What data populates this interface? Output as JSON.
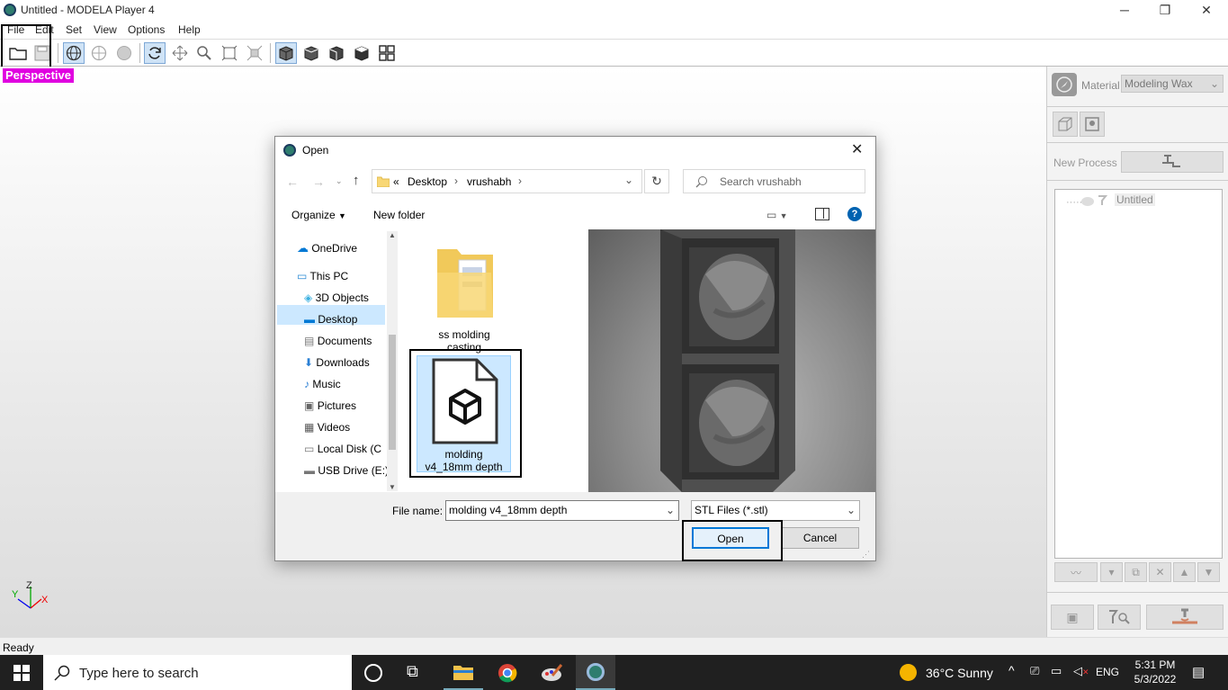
{
  "window": {
    "title": "Untitled - MODELA Player 4",
    "min": "─",
    "max": "❐",
    "close": "✕"
  },
  "menu": {
    "file": "File",
    "edit": "Edit",
    "set": "Set",
    "view": "View",
    "options": "Options",
    "help": "Help"
  },
  "viewport": {
    "label": "Perspective",
    "axis_x": "X",
    "axis_y": "Y",
    "axis_z": "Z"
  },
  "right_panel": {
    "material_label": "Material",
    "material_value": "Modeling Wax",
    "new_process": "New Process",
    "tree_root": "Untitled"
  },
  "status": {
    "text": "Ready"
  },
  "dialog": {
    "title": "Open",
    "breadcrumb": {
      "sep": "«",
      "seg1": "Desktop",
      "seg2": "vrushabh"
    },
    "search_placeholder": "Search vrushabh",
    "organize": "Organize",
    "new_folder": "New folder",
    "nav": [
      {
        "label": "OneDrive"
      },
      {
        "label": "This PC"
      },
      {
        "label": "3D Objects"
      },
      {
        "label": "Desktop"
      },
      {
        "label": "Documents"
      },
      {
        "label": "Downloads"
      },
      {
        "label": "Music"
      },
      {
        "label": "Pictures"
      },
      {
        "label": "Videos"
      },
      {
        "label": "Local Disk (C"
      },
      {
        "label": "USB Drive (E:)"
      }
    ],
    "files": [
      {
        "name_line1": "ss molding",
        "name_line2": "casting"
      },
      {
        "name_line1": "molding",
        "name_line2": "v4_18mm depth"
      }
    ],
    "file_name_label": "File name:",
    "file_name_value": "molding v4_18mm depth",
    "file_type_value": "STL Files (*.stl)",
    "open": "Open",
    "cancel": "Cancel"
  },
  "taskbar": {
    "search_placeholder": "Type here to search",
    "weather": "36°C  Sunny",
    "lang": "ENG",
    "time": "5:31 PM",
    "date": "5/3/2022"
  },
  "colors": {
    "accent": "#0078d7",
    "perspective_bg": "#e000e0",
    "selection": "#cce8ff"
  }
}
